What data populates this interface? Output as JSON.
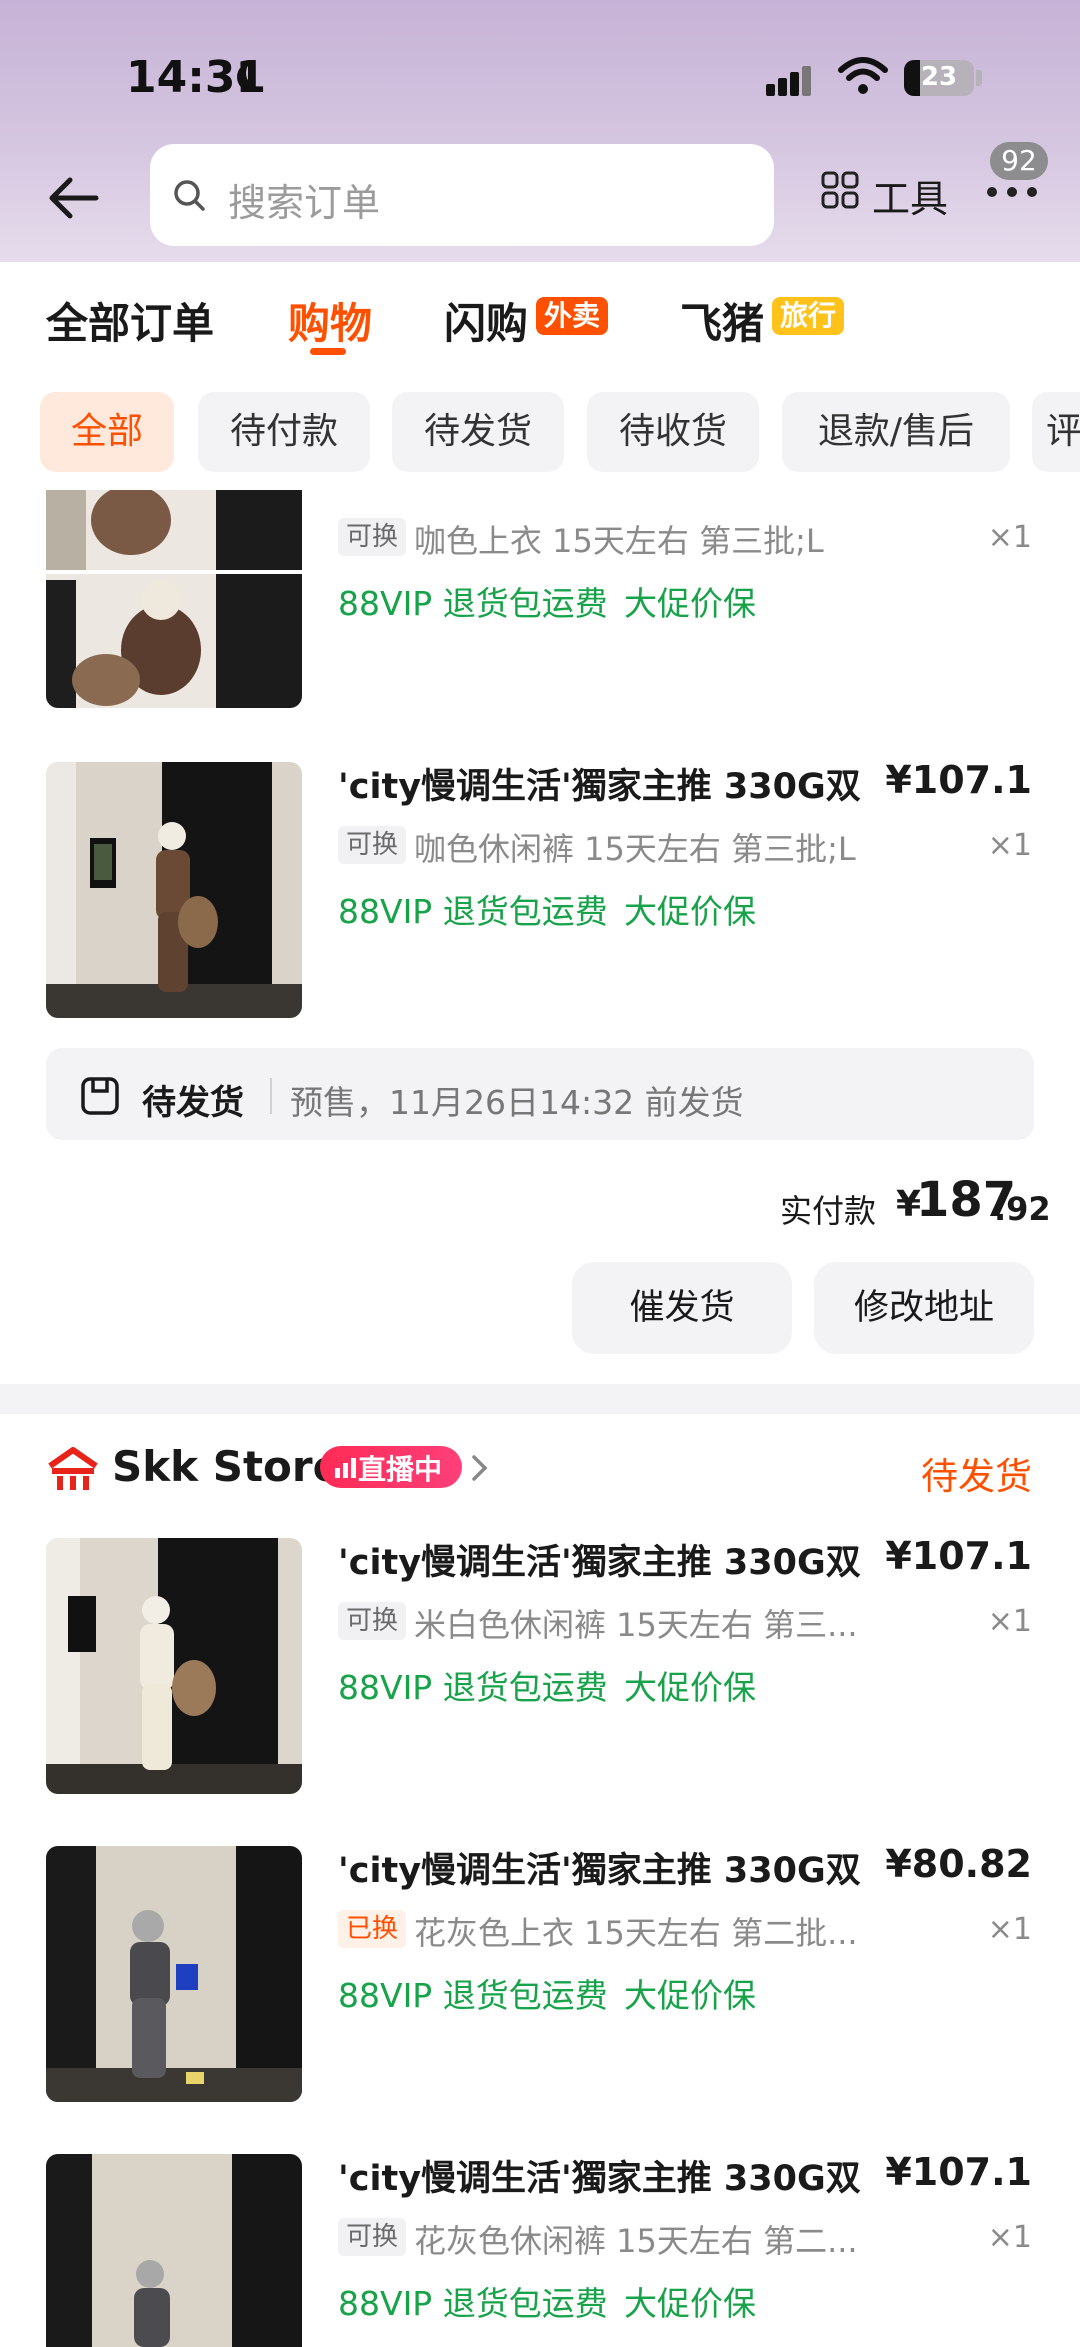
{
  "status_bar": {
    "time": "14:31",
    "battery": "23",
    "battery_level": 0.23
  },
  "header": {
    "search_placeholder": "搜索订单",
    "tools_label": "工具",
    "more_badge": "92"
  },
  "categories": [
    {
      "label": "全部订单"
    },
    {
      "label": "购物"
    },
    {
      "label": "闪购",
      "tag": "外卖"
    },
    {
      "label": "飞猪",
      "tag": "旅行"
    }
  ],
  "filters": [
    "全部",
    "待付款",
    "待发货",
    "待收货",
    "退款/售后",
    "评"
  ],
  "order1": {
    "items": [
      {
        "swap": "可换",
        "variant": "咖色上衣 15天左右 第三批;L",
        "qty": "×1",
        "perks": [
          "88VIP 退货包运费",
          "大促价保"
        ]
      },
      {
        "title": "'city慢调生活'獨家主推 330G双",
        "price": "¥107.1",
        "swap": "可换",
        "variant": "咖色休闲裤 15天左右 第三批;L",
        "qty": "×1",
        "perks": [
          "88VIP 退货包运费",
          "大促价保"
        ]
      }
    ],
    "shipping": {
      "status": "待发货",
      "detail": "预售，11月26日14:32 前发货"
    },
    "paid": {
      "label": "实付款",
      "yen": "¥",
      "main": "187",
      "decimal": ".92"
    },
    "actions": [
      "催发货",
      "修改地址"
    ]
  },
  "order2": {
    "store": {
      "name": "Skk Store",
      "live": "直播中",
      "status": "待发货"
    },
    "items": [
      {
        "title": "'city慢调生活'獨家主推 330G双",
        "price": "¥107.1",
        "swap": "可换",
        "variant": "米白色休闲裤 15天左右 第三...",
        "qty": "×1",
        "perks": [
          "88VIP 退货包运费",
          "大促价保"
        ]
      },
      {
        "title": "'city慢调生活'獨家主推 330G双",
        "price": "¥80.82",
        "swap": "已换",
        "variant": "花灰色上衣 15天左右 第二批...",
        "qty": "×1",
        "perks": [
          "88VIP 退货包运费",
          "大促价保"
        ]
      },
      {
        "title": "'city慢调生活'獨家主推 330G双",
        "price": "¥107.1",
        "swap": "可换",
        "variant": "花灰色休闲裤 15天左右 第二...",
        "qty": "×1",
        "perks": [
          "88VIP 退货包运费",
          "大促价保"
        ]
      }
    ]
  },
  "colors": {
    "accent": "#ff5000",
    "perk_green": "#18a34a",
    "live_pink": "#ff2b55",
    "tag_yellow": "#ffc21a"
  }
}
